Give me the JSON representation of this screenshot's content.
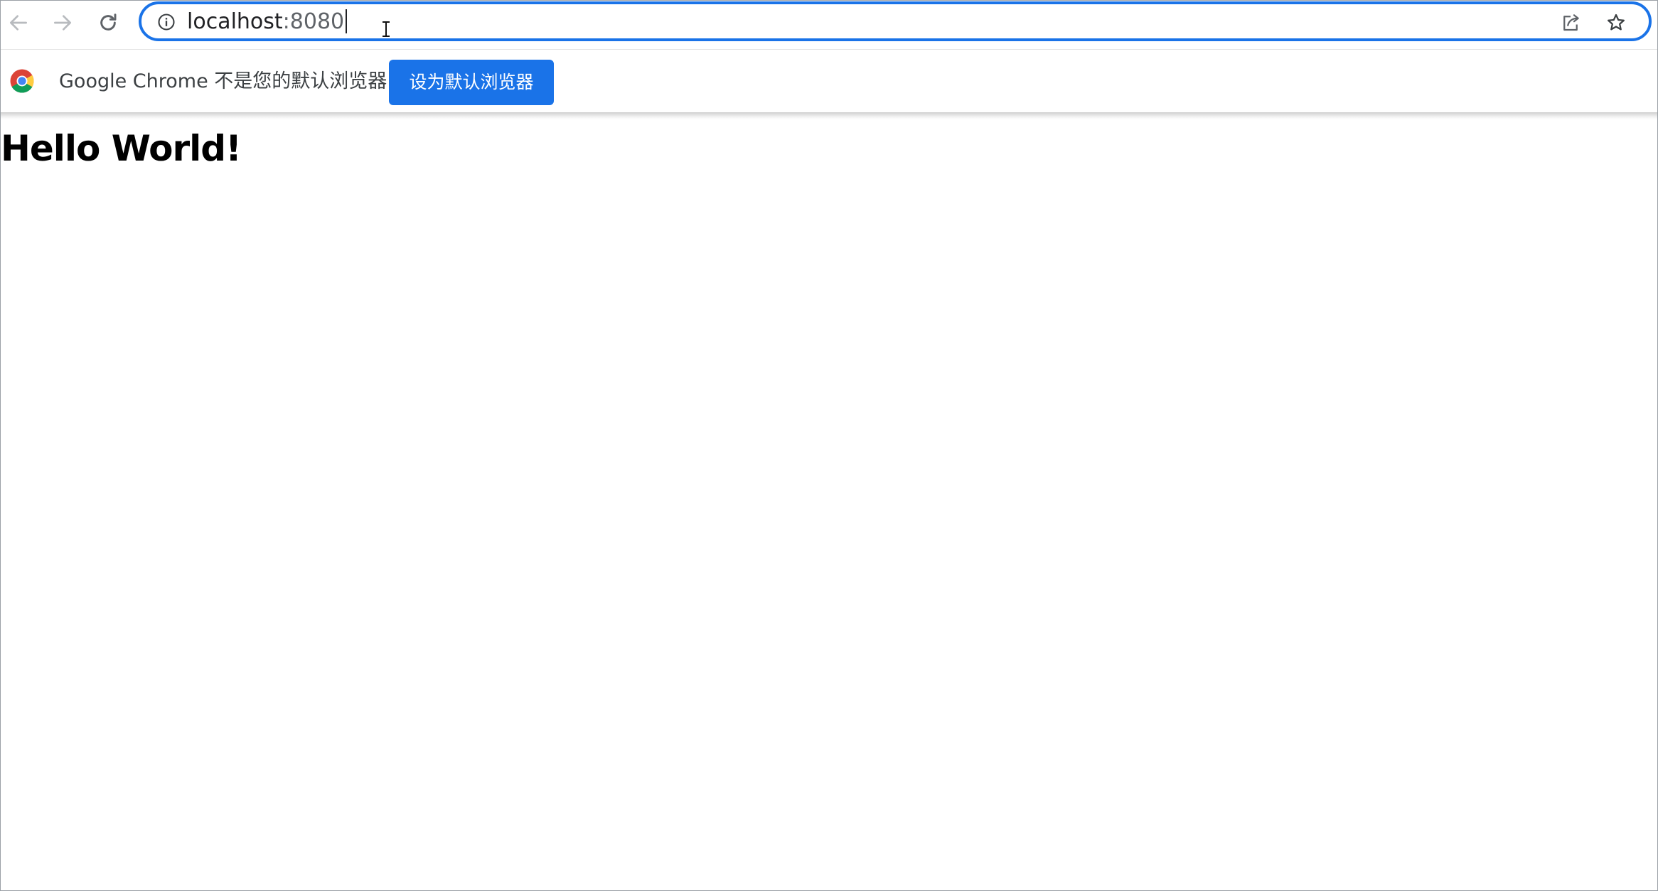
{
  "toolbar": {
    "back_icon": "arrow-left-icon",
    "forward_icon": "arrow-right-icon",
    "reload_icon": "reload-icon"
  },
  "omnibox": {
    "url_host": "localhost",
    "url_port": ":8080",
    "site_info_icon": "info-circle-icon",
    "share_icon": "share-icon",
    "bookmark_icon": "star-icon",
    "focus_color": "#1a73e8"
  },
  "infobar": {
    "message": "Google Chrome 不是您的默认浏览器",
    "button_label": "设为默认浏览器",
    "button_color": "#1a73e8"
  },
  "page": {
    "heading": "Hello World!"
  }
}
